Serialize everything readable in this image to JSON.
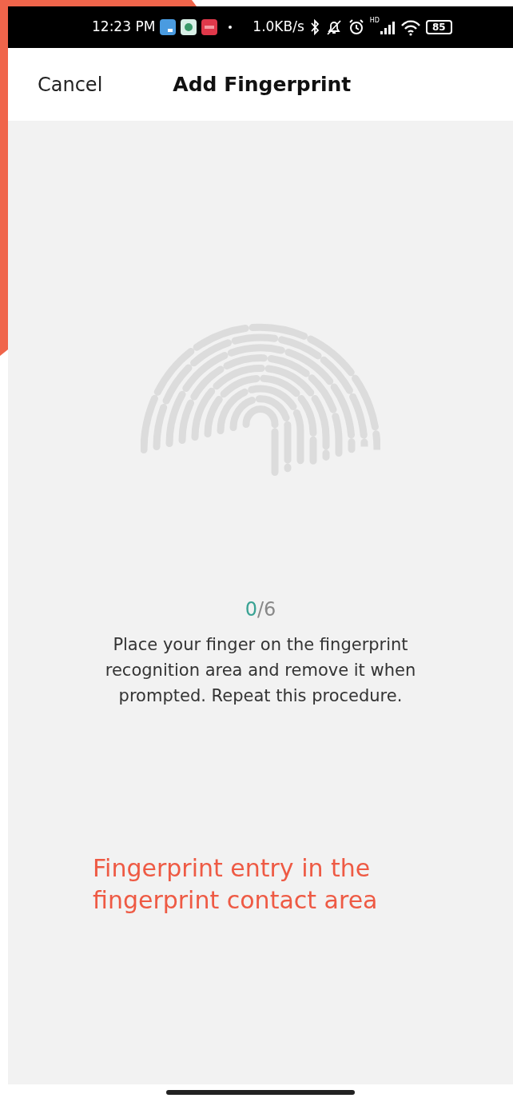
{
  "status_bar": {
    "time": "12:23 PM",
    "speed": "1.0KB/s",
    "network_label": "HD",
    "battery": "85"
  },
  "header": {
    "cancel": "Cancel",
    "title": "Add Fingerprint"
  },
  "progress": {
    "current": "0",
    "total": "/6"
  },
  "instruction": "Place your finger on the fingerprint recognition area and remove it when prompted. Repeat this procedure.",
  "annotation": "Fingerprint entry in the fingerprint contact area"
}
